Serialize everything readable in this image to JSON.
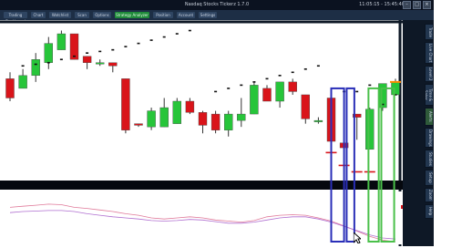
{
  "window": {
    "title": "Nasdaq Stocks Tickerz 1.7.0",
    "status": "11:05:15 - 15:45:40"
  },
  "toolbar": {
    "items": [
      {
        "label": "Trading Dashboard"
      },
      {
        "label": "Chart"
      },
      {
        "label": "Watchlist"
      },
      {
        "label": "Scan"
      },
      {
        "label": "Options"
      },
      {
        "label": "Strategy Analyzer"
      },
      {
        "label": "Position"
      },
      {
        "label": "Account"
      },
      {
        "label": "Settings"
      }
    ],
    "active_index": 5
  },
  "sidebar": {
    "buttons": [
      {
        "label": "Trade"
      },
      {
        "label": "Live Chart"
      },
      {
        "label": "Level 2"
      },
      {
        "label": "Time & Sales"
      },
      {
        "label": "Alerts"
      },
      {
        "label": "Drawings"
      },
      {
        "label": "Studies"
      },
      {
        "label": "Setup"
      },
      {
        "label": "Zoom"
      },
      {
        "label": "Help"
      }
    ],
    "active_index": 4
  },
  "chart_data": {
    "type": "candlestick",
    "grid": false,
    "candles": [
      {
        "o": 40,
        "h": 42,
        "l": 33,
        "c": 34
      },
      {
        "o": 37,
        "h": 43,
        "l": 37,
        "c": 41
      },
      {
        "o": 41,
        "h": 48,
        "l": 39,
        "c": 46
      },
      {
        "o": 45,
        "h": 53,
        "l": 43,
        "c": 51
      },
      {
        "o": 49,
        "h": 55,
        "l": 49,
        "c": 54
      },
      {
        "o": 54,
        "h": 54,
        "l": 46,
        "c": 46
      },
      {
        "o": 47,
        "h": 47,
        "l": 43,
        "c": 45
      },
      {
        "o": 45,
        "h": 46,
        "l": 44,
        "c": 45
      },
      {
        "o": 45,
        "h": 45,
        "l": 42,
        "c": 44
      },
      {
        "o": 40,
        "h": 40,
        "l": 23,
        "c": 24
      },
      {
        "o": 26,
        "h": 26,
        "l": 25,
        "c": 25.5
      },
      {
        "o": 25,
        "h": 31,
        "l": 24,
        "c": 30
      },
      {
        "o": 25,
        "h": 34,
        "l": 25,
        "c": 31
      },
      {
        "o": 26,
        "h": 34,
        "l": 26,
        "c": 33
      },
      {
        "o": 33,
        "h": 34,
        "l": 29,
        "c": 29.5
      },
      {
        "o": 29.5,
        "h": 30,
        "l": 23,
        "c": 25.5
      },
      {
        "o": 29,
        "h": 30,
        "l": 23,
        "c": 24
      },
      {
        "o": 24,
        "h": 30,
        "l": 22,
        "c": 29
      },
      {
        "o": 27,
        "h": 34,
        "l": 25,
        "c": 29
      },
      {
        "o": 29,
        "h": 39,
        "l": 29,
        "c": 38
      },
      {
        "o": 37,
        "h": 38,
        "l": 33,
        "c": 33
      },
      {
        "o": 33,
        "h": 38,
        "l": 31,
        "c": 39
      },
      {
        "o": 39,
        "h": 40,
        "l": 35,
        "c": 36
      },
      {
        "o": 35,
        "h": 35,
        "l": 26,
        "c": 27.5
      },
      {
        "o": 27,
        "h": 28,
        "l": 26,
        "c": 27
      },
      {
        "o": 34,
        "h": 34,
        "l": 24,
        "c": 20.5
      },
      {
        "o": 20,
        "h": 22,
        "l": 18,
        "c": 18.5
      },
      {
        "o": 29,
        "h": 29,
        "l": 21,
        "c": 28
      },
      {
        "o": 18,
        "h": 31,
        "l": 18,
        "c": 30.5
      },
      {
        "o": 31,
        "h": 38,
        "l": 30,
        "c": 38.5
      },
      {
        "o": 35,
        "h": 40,
        "l": 35,
        "c": 39
      }
    ],
    "sar": [
      null,
      44,
      44.5,
      45,
      46,
      47,
      48,
      48.5,
      49,
      50,
      51,
      52,
      53,
      54,
      55,
      null,
      36,
      37,
      38,
      39,
      40,
      41,
      42,
      43,
      44,
      null,
      36,
      36,
      38,
      32,
      35
    ],
    "stop_levels": [
      {
        "index": 25,
        "value": 17
      },
      {
        "index": 26,
        "value": 13
      },
      {
        "index": 27,
        "value": 11
      },
      {
        "index": 28,
        "value": 11
      }
    ],
    "targets": [
      {
        "index": 30,
        "value": 39
      }
    ],
    "oscillator": {
      "line_a": [
        70,
        72,
        74,
        76,
        75,
        70,
        68,
        65,
        62,
        58,
        55,
        50,
        48,
        50,
        52,
        50,
        46,
        44,
        42,
        45,
        52,
        55,
        56,
        55,
        50,
        44,
        35,
        25,
        15,
        8,
        5
      ],
      "line_b": [
        60,
        62,
        63,
        64,
        64,
        62,
        58,
        55,
        52,
        50,
        48,
        45,
        44,
        45,
        47,
        46,
        43,
        40,
        40,
        42,
        46,
        50,
        52,
        52,
        48,
        42,
        34,
        26,
        18,
        12,
        10
      ]
    },
    "highlight_boxes": [
      {
        "color": "#2a2fb8",
        "from": 25.5,
        "to": 26.5
      },
      {
        "color": "#2a2fb8",
        "from": 26.7,
        "to": 27.3
      },
      {
        "color": "#4ac04a",
        "from": 28.4,
        "to": 29.2
      },
      {
        "color": "#4ac04a",
        "from": 29.4,
        "to": 30.4
      }
    ],
    "colors": {
      "up": "#27c53a",
      "down": "#d9141a",
      "sar": "#111111",
      "stop": "#d9141a",
      "target": "#ff8a00"
    }
  }
}
